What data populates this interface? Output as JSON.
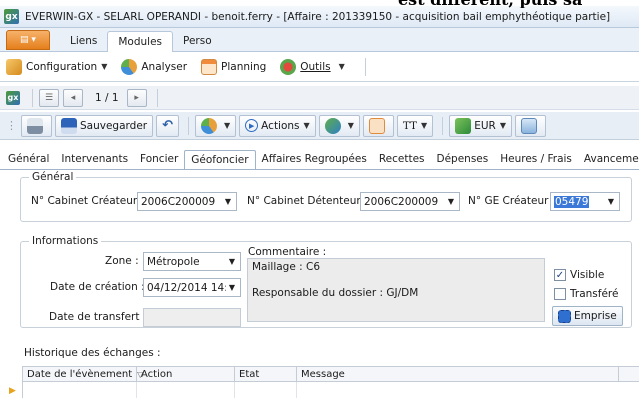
{
  "overlay_text": "est différent, puis sa",
  "window": {
    "title": "EVERWIN-GX - SELARL OPERANDI - benoit.ferry - [Affaire : 201339150 - acquisition bail emphythéotique partie]"
  },
  "menu": {
    "tabs": [
      "Liens",
      "Modules",
      "Perso"
    ],
    "active": "Modules"
  },
  "ribbon": {
    "configuration": "Configuration",
    "analyser": "Analyser",
    "planning": "Planning",
    "outils": "Outils"
  },
  "nav": {
    "pager": "1 / 1"
  },
  "toolbar": {
    "save": "Sauvegarder",
    "actions": "Actions",
    "tt": "TT",
    "currency": "EUR"
  },
  "tabs": [
    "Général",
    "Intervenants",
    "Foncier",
    "Géofoncier",
    "Affaires Regroupées",
    "Recettes",
    "Dépenses",
    "Heures / Frais",
    "Avanceme"
  ],
  "active_tab": "Géofoncier",
  "general": {
    "legend": "Général",
    "cabinet_createur_label": "N° Cabinet Créateur :",
    "cabinet_createur_value": "2006C200009",
    "cabinet_detenteur_label": "N° Cabinet Détenteur :",
    "cabinet_detenteur_value": "2006C200009",
    "ge_createur_label": "N° GE Créateur :",
    "ge_createur_value": "05479"
  },
  "informations": {
    "legend": "Informations",
    "zone_label": "Zone :",
    "zone_value": "Métropole",
    "date_creation_label": "Date de création :",
    "date_creation_value": "04/12/2014 14::",
    "date_transfert_label": "Date de transfert :",
    "commentaire_label": "Commentaire :",
    "commentaire_line1": "Maillage : C6",
    "commentaire_line2": "Responsable du dossier : GJ/DM",
    "visible_label": "Visible",
    "visible_checked": true,
    "transfere_label": "Transféré",
    "transfere_checked": false,
    "emprise_label": "Emprise"
  },
  "historique": {
    "title": "Historique des échanges :",
    "columns": [
      "Date de l'évènement",
      "Action",
      "Etat",
      "Message"
    ]
  }
}
